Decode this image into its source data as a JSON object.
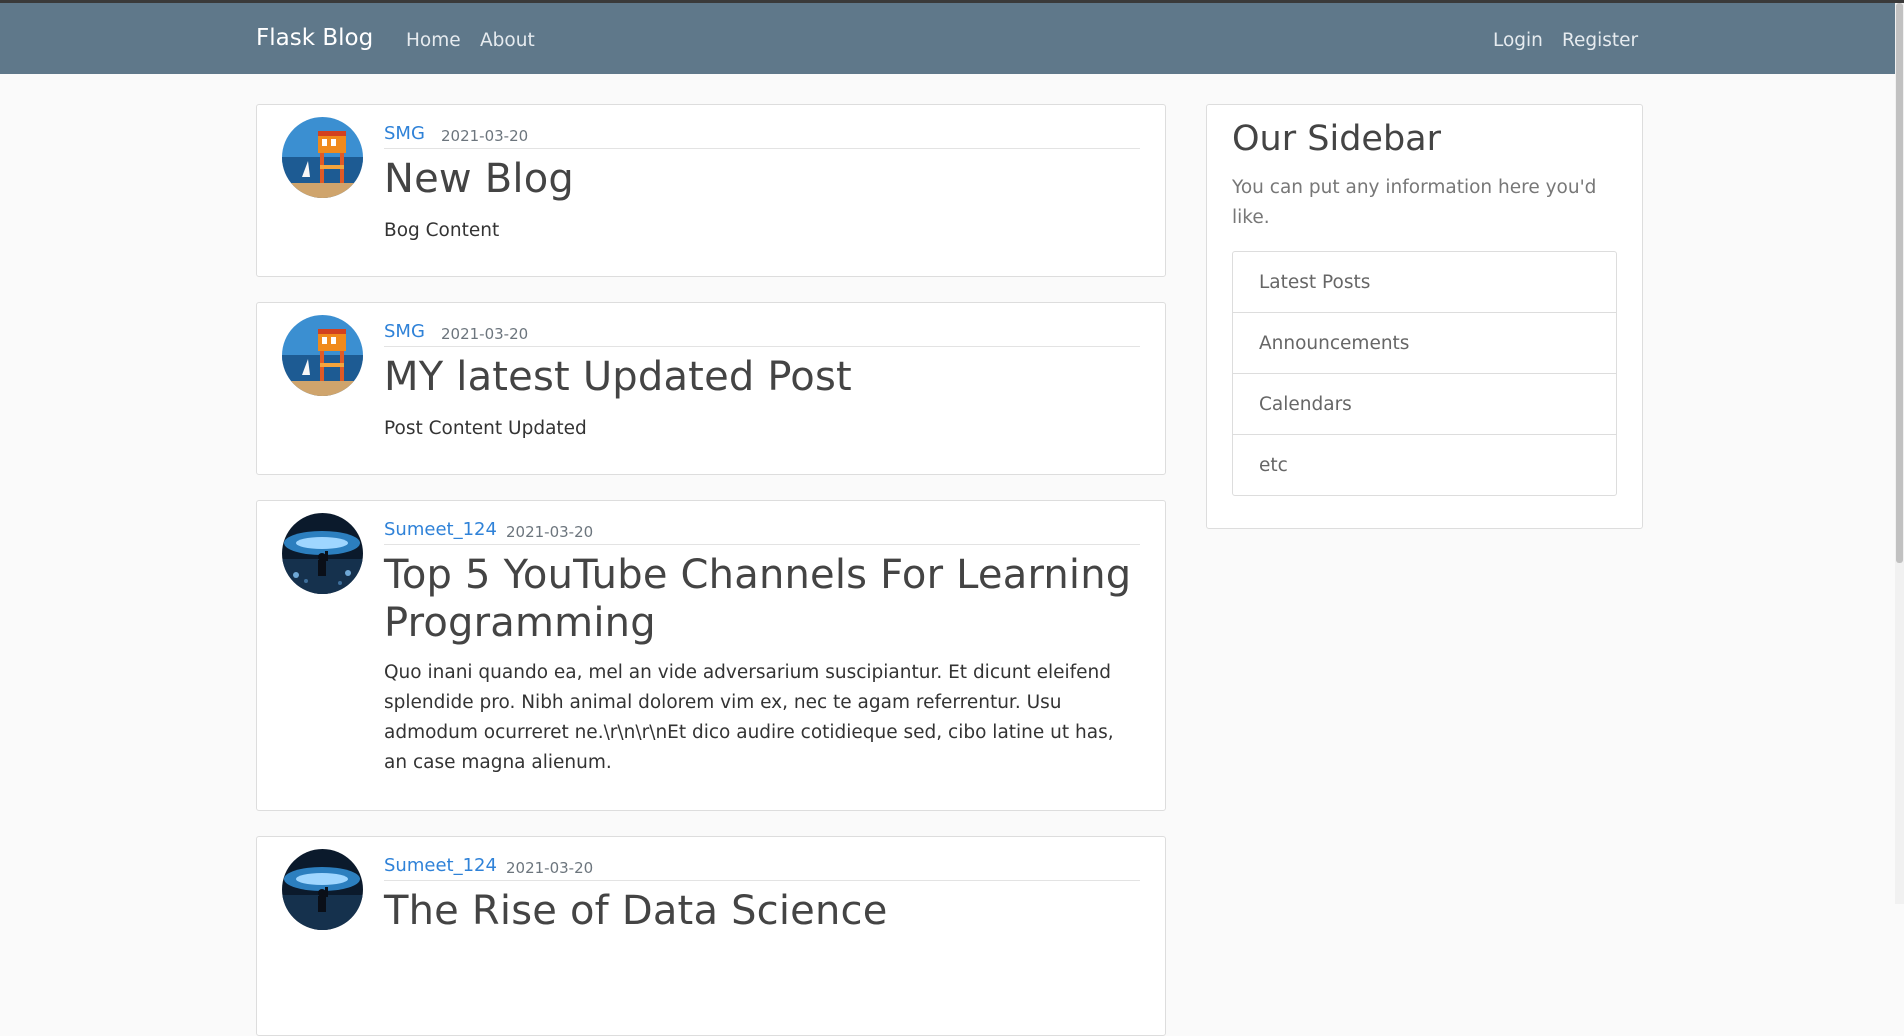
{
  "navbar": {
    "brand": "Flask Blog",
    "home": "Home",
    "about": "About",
    "login": "Login",
    "register": "Register"
  },
  "posts": [
    {
      "author": "SMG",
      "date": "2021-03-20",
      "title": "New Blog",
      "content": "Bog Content",
      "avatar": "beach-lifeguard-tower-avatar"
    },
    {
      "author": "SMG",
      "date": "2021-03-20",
      "title": "MY latest Updated Post",
      "content": "Post Content Updated",
      "avatar": "beach-lifeguard-tower-avatar"
    },
    {
      "author": "Sumeet_124",
      "date": "2021-03-20",
      "title": "Top 5 YouTube Channels For Learning Programming",
      "content": "Quo inani quando ea, mel an vide adversarium suscipiantur. Et dicunt eleifend splendide pro. Nibh animal dolorem vim ex, nec te agam referrentur. Usu admodum ocurreret ne.\\r\\n\\r\\nEt dico audire cotidieque sed, cibo latine ut has, an case magna alienum.",
      "avatar": "concert-crowd-avatar"
    },
    {
      "author": "Sumeet_124",
      "date": "2021-03-20",
      "title": "The Rise of Data Science",
      "avatar": "concert-crowd-avatar"
    }
  ],
  "sidebar": {
    "title": "Our Sidebar",
    "description": "You can put any information here you'd like.",
    "items": [
      "Latest Posts",
      "Announcements",
      "Calendars",
      "etc"
    ]
  },
  "colors": {
    "navbar": "#5f788a",
    "link": "#2f82d8",
    "background": "#fafafa"
  }
}
